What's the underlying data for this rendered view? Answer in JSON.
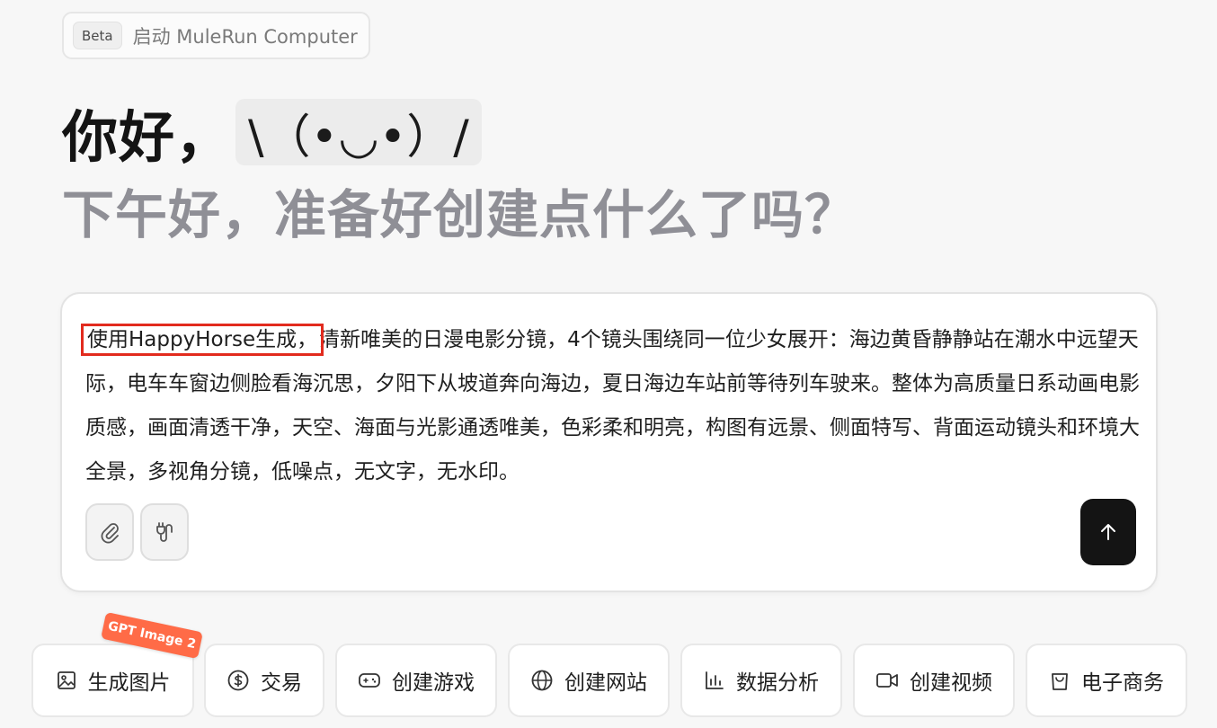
{
  "launch": {
    "badge": "Beta",
    "label": "启动 MuleRun Computer",
    "arrow_icon": "external-arrow-icon"
  },
  "greeting": {
    "hello": "你好，",
    "kaomoji": "\\（•◡•）/",
    "subtitle": "下午好，准备好创建点什么了吗？"
  },
  "prompt": {
    "highlighted": "使用HappyHorse生成，",
    "text": "清新唯美的日漫电影分镜，4个镜头围绕同一位少女展开：海边黄昏静静站在潮水中远望天际，电车车窗边侧脸看海沉思，夕阳下从坡道奔向海边，夏日海边车站前等待列车驶来。整体为高质量日系动画电影质感，画面清透干净，天空、海面与光影通透唯美，色彩柔和明亮，构图有远景、侧面特写、背面运动镜头和环境大全景，多视角分镜，低噪点，无文字，无水印。",
    "highlight_color": "#e22b1e"
  },
  "tools": {
    "attach_icon": "paperclip-icon",
    "connect_icon": "plug-icon",
    "send_icon": "arrow-up-icon"
  },
  "actions": [
    {
      "label": "生成图片",
      "icon": "image-icon",
      "tag": "GPT Image 2"
    },
    {
      "label": "交易",
      "icon": "dollar-icon"
    },
    {
      "label": "创建游戏",
      "icon": "gamepad-icon"
    },
    {
      "label": "创建网站",
      "icon": "globe-icon"
    },
    {
      "label": "数据分析",
      "icon": "bar-chart-icon"
    },
    {
      "label": "创建视频",
      "icon": "video-icon"
    },
    {
      "label": "电子商务",
      "icon": "shopping-bag-icon"
    }
  ],
  "colors": {
    "background": "#f7f7f7",
    "accent_tag": "#ff6b47",
    "send_button": "#141414"
  }
}
